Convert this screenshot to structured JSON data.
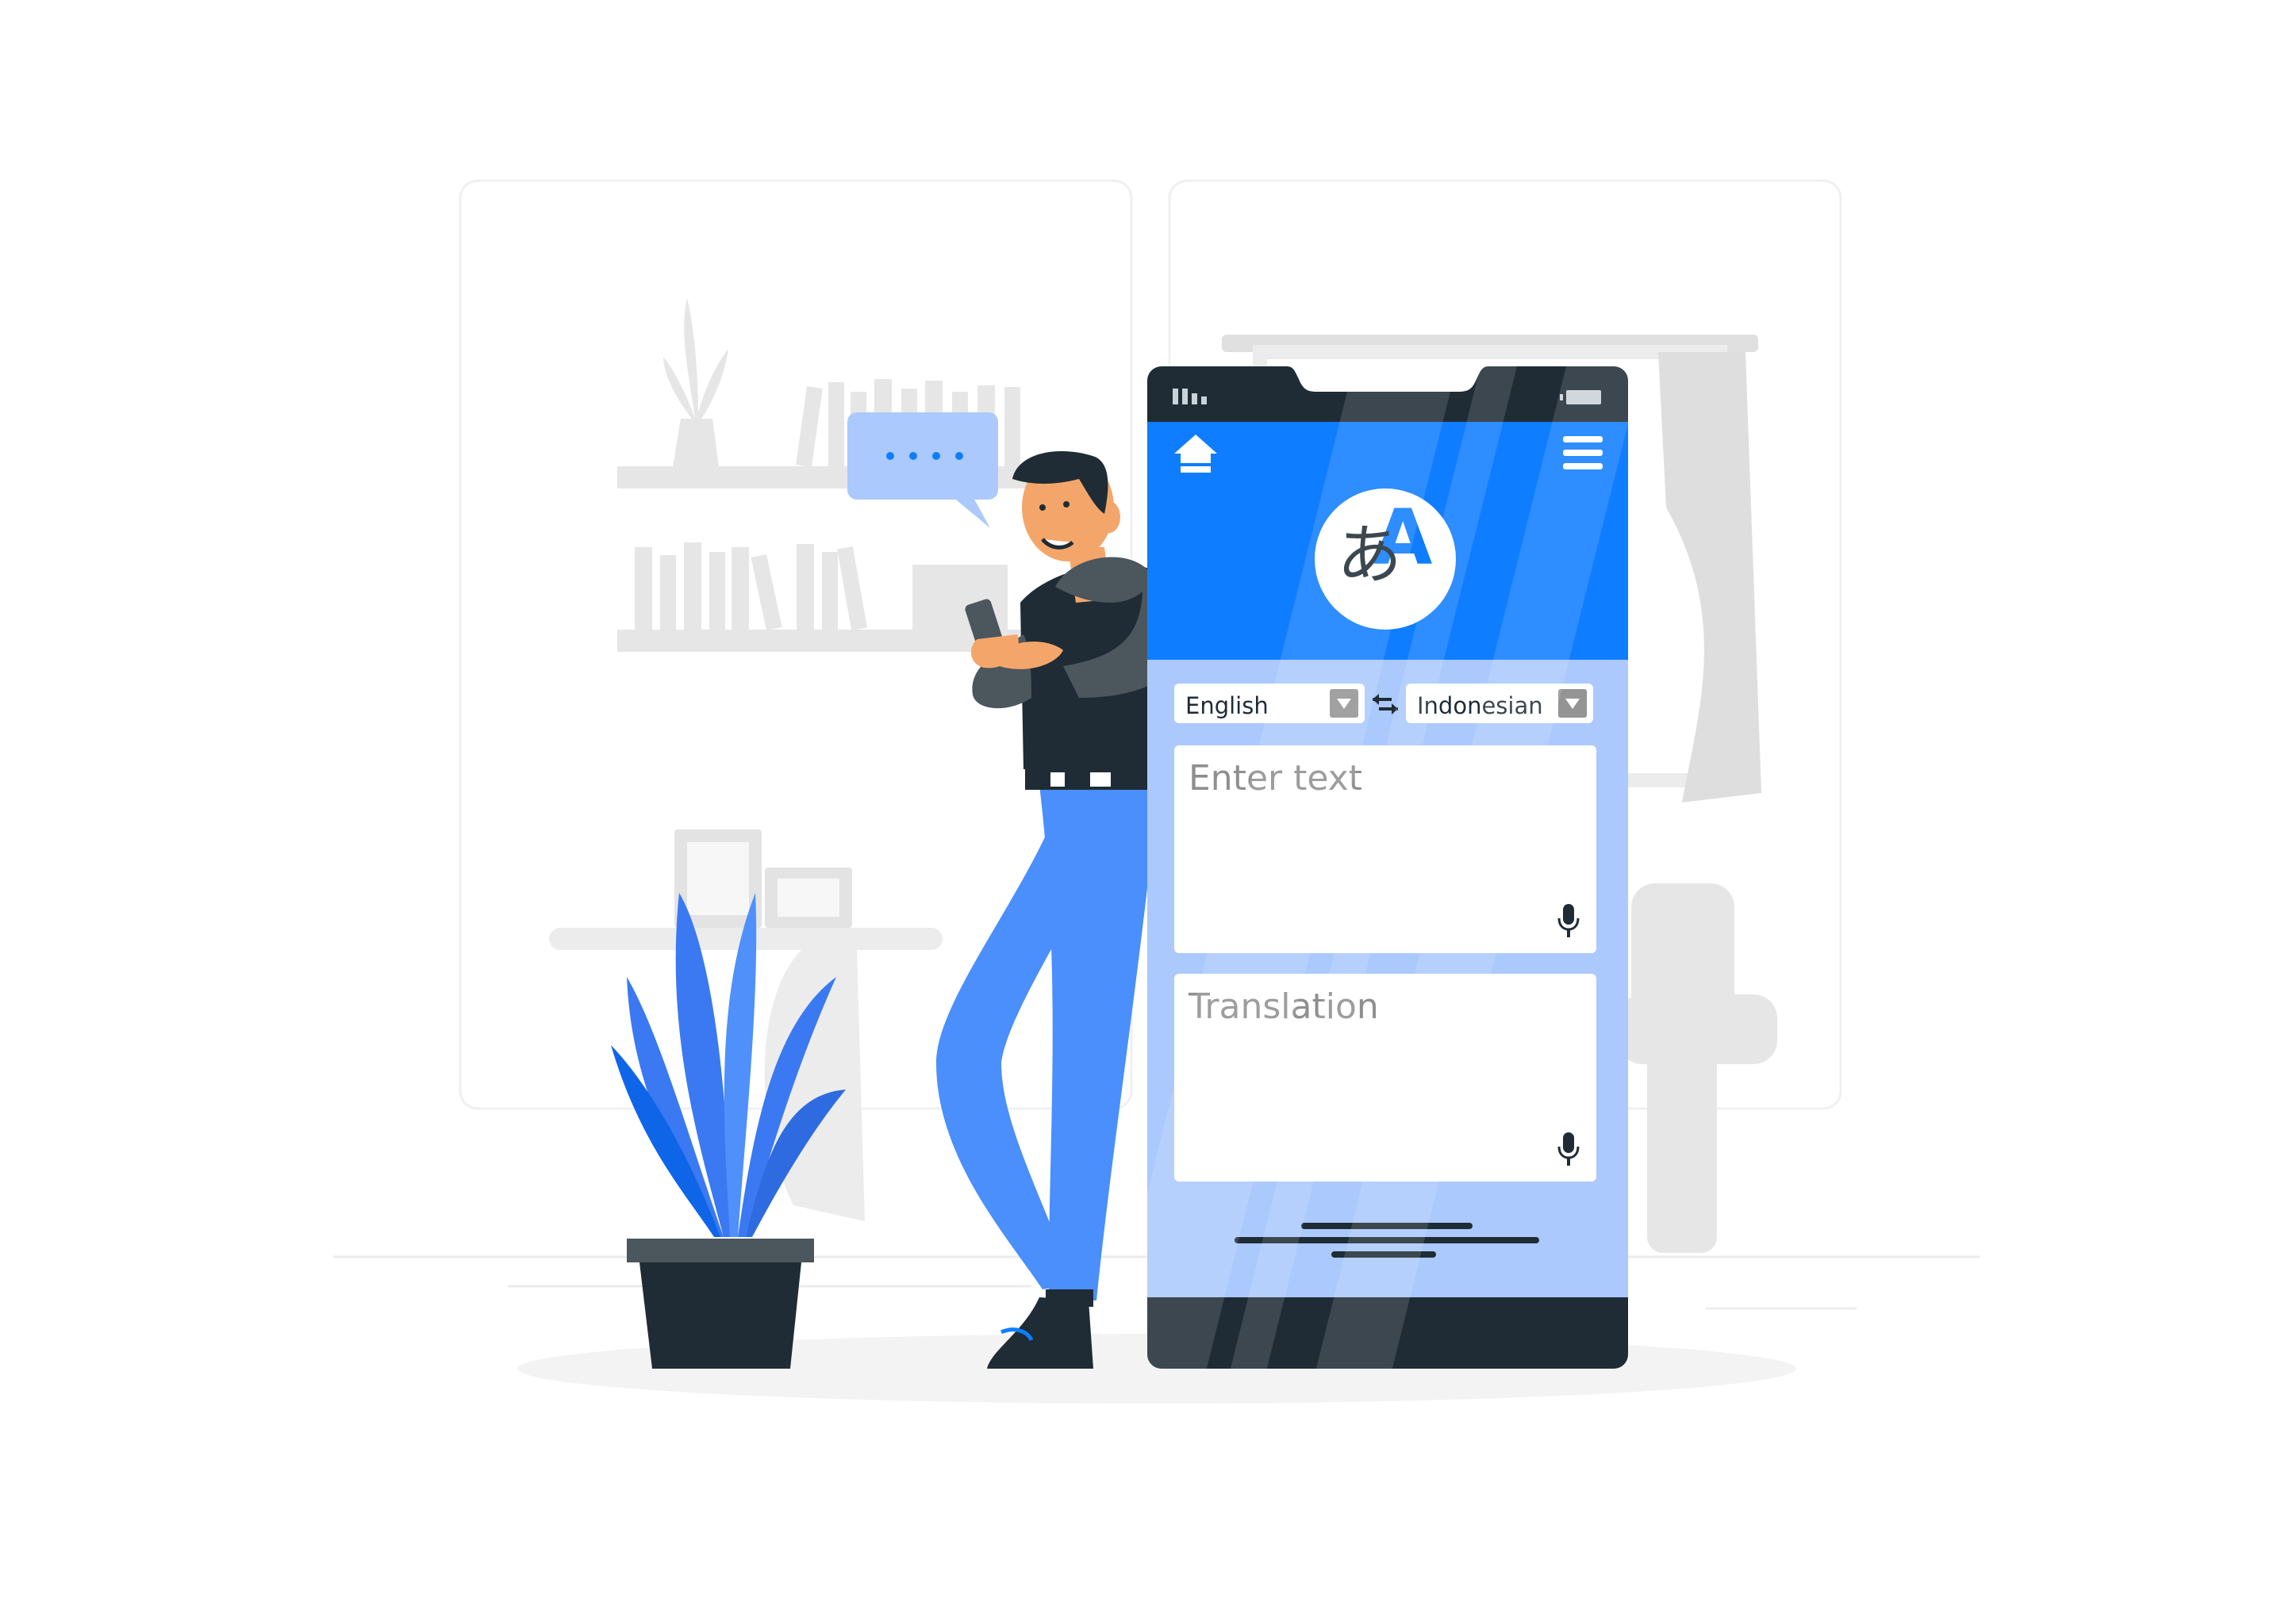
{
  "colors": {
    "accent": "#0f7dff",
    "phone_body_light": "#abc9fc",
    "dark": "#1f2c35",
    "placeholder_gray": "#8f8f8f",
    "background_gray": "#ebebeb"
  },
  "status_bar": {
    "signal_icon": "signal-bars-icon",
    "battery_icon": "battery-icon"
  },
  "app_header": {
    "home_icon": "home-icon",
    "menu_icon": "hamburger-menu-icon",
    "logo_icon": "translate-icon",
    "logo": {
      "latin": "A",
      "japanese": "あ"
    }
  },
  "language_bar": {
    "source_language": "English",
    "target_language": "Indonesian",
    "swap_icon": "swap-arrows-icon",
    "dropdown_icon": "chevron-down-icon"
  },
  "input_box": {
    "placeholder": "Enter text",
    "mic_icon": "microphone-icon"
  },
  "output_box": {
    "placeholder": "Translation",
    "mic_icon": "microphone-icon"
  },
  "speech_bubble": {
    "content": "...."
  }
}
